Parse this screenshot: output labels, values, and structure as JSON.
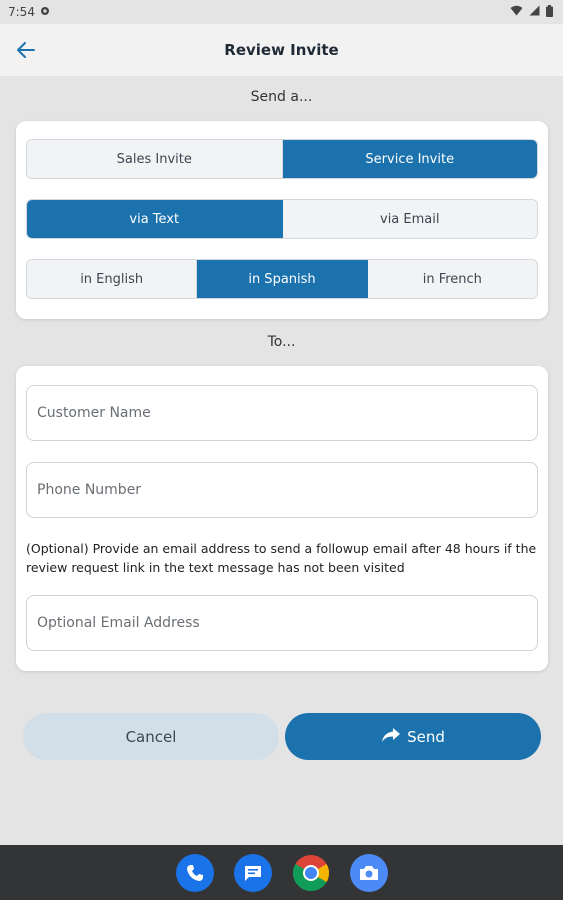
{
  "status_bar": {
    "time": "7:54"
  },
  "app_bar": {
    "title": "Review Invite"
  },
  "send_section": {
    "label": "Send a..."
  },
  "invite_type": {
    "options": [
      {
        "label": "Sales Invite",
        "active": false
      },
      {
        "label": "Service Invite",
        "active": true
      }
    ]
  },
  "channel": {
    "options": [
      {
        "label": "via Text",
        "active": true
      },
      {
        "label": "via Email",
        "active": false
      }
    ]
  },
  "language": {
    "options": [
      {
        "label": "in English",
        "active": false
      },
      {
        "label": "in Spanish",
        "active": true
      },
      {
        "label": "in French",
        "active": false
      }
    ]
  },
  "to_section": {
    "label": "To..."
  },
  "form": {
    "customer_name": {
      "placeholder": "Customer Name",
      "value": ""
    },
    "phone_number": {
      "placeholder": "Phone Number",
      "value": ""
    },
    "optional_note": "(Optional) Provide an email address to send a followup email after 48 hours if the review request link in the text message has not been visited",
    "email": {
      "placeholder": "Optional Email Address",
      "value": ""
    }
  },
  "actions": {
    "cancel_label": "Cancel",
    "send_label": "Send"
  },
  "colors": {
    "accent": "#1b72ad",
    "cancel_bg": "#d2dfe9",
    "background": "#e4e4e4"
  },
  "dock": {
    "icons": [
      "phone-icon",
      "messages-icon",
      "chrome-icon",
      "camera-icon"
    ]
  }
}
